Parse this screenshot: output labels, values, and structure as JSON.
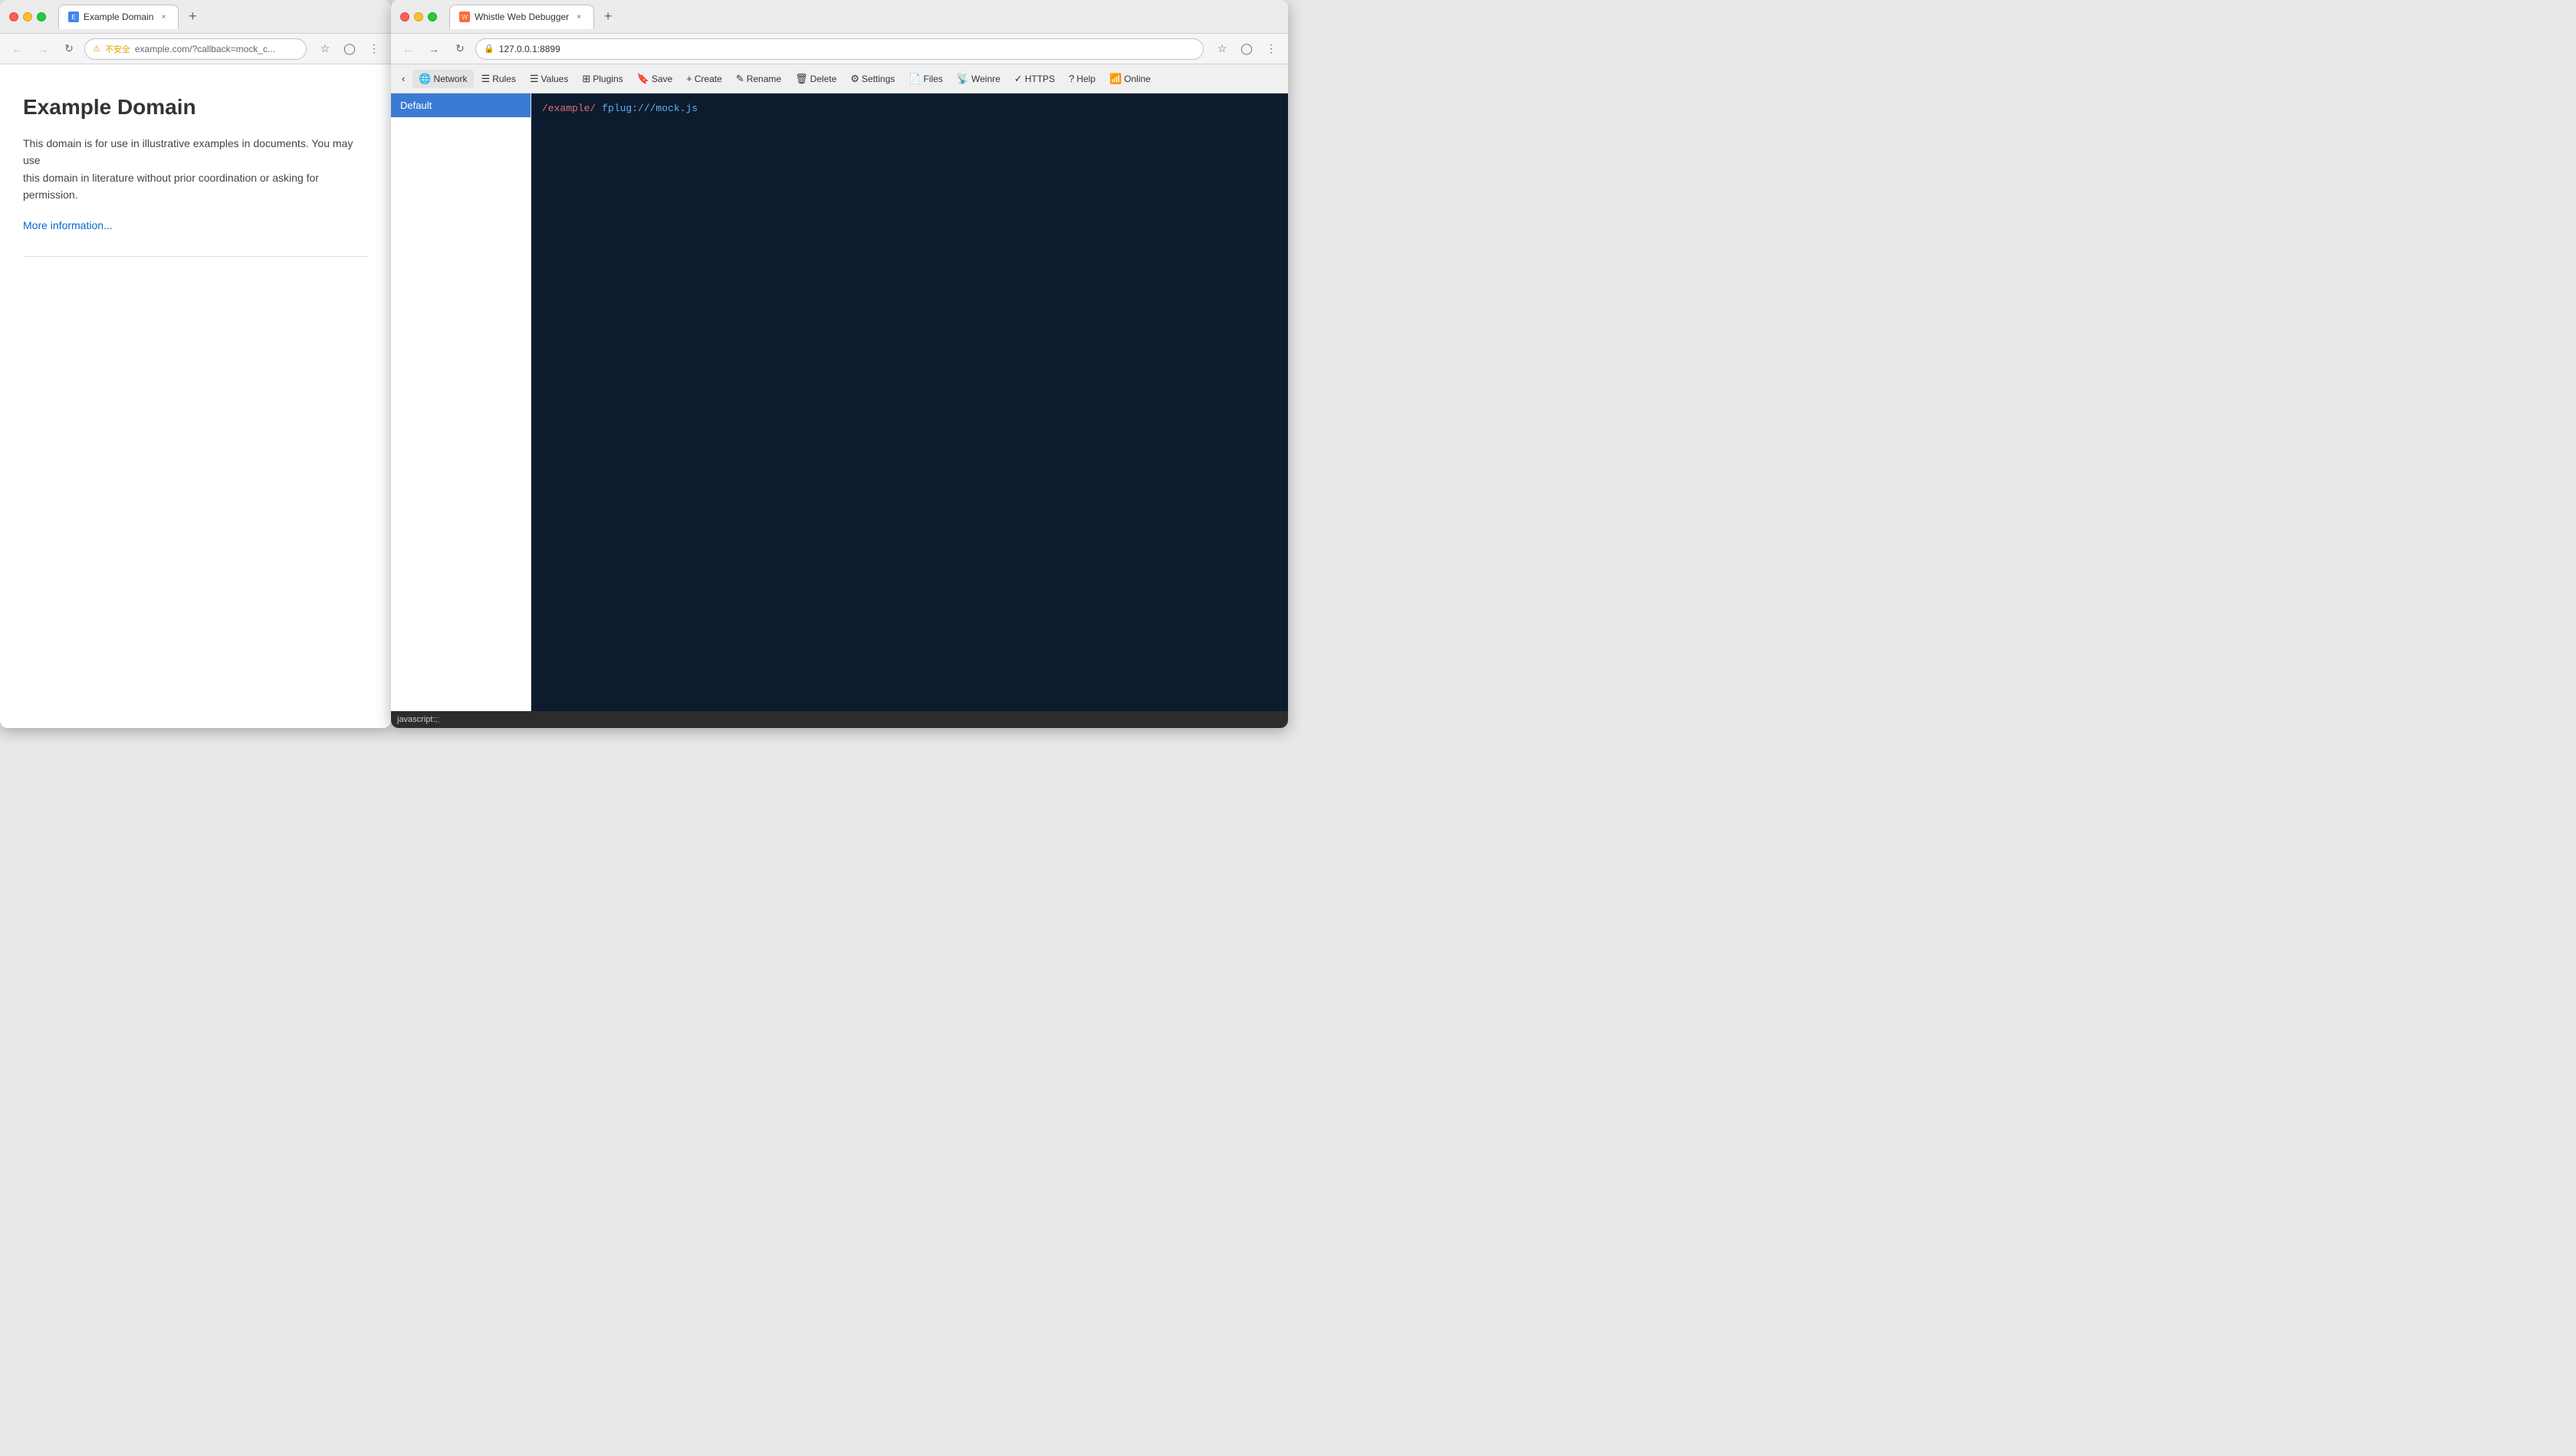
{
  "browser1": {
    "tab_label": "Example Domain",
    "tab_close": "×",
    "tab_new": "+",
    "nav": {
      "back": "←",
      "forward": "→",
      "reload": "↻",
      "security_label": "不安全",
      "url": "example.com/?callback=mock_c...",
      "bookmark_icon": "☆",
      "account_icon": "◯",
      "more_icon": "⋮"
    },
    "page": {
      "title": "Example Domain",
      "description_1": "This domain is for use in illustrative examples in documents. You may use",
      "description_2": "this domain in literature without prior coordination or asking for",
      "description_3": "permission.",
      "link_text": "More information..."
    }
  },
  "browser2": {
    "tab_label": "Whistle Web Debugger",
    "tab_close": "×",
    "tab_new": "+",
    "nav": {
      "back": "←",
      "forward": "→",
      "reload": "↻",
      "url": "127.0.0.1:8899",
      "bookmark_icon": "☆",
      "account_icon": "◯",
      "more_icon": "⋮"
    },
    "toolbar": {
      "back": "‹",
      "network": "Network",
      "rules": "Rules",
      "values": "Values",
      "plugins": "Plugins",
      "save": "Save",
      "create": "Create",
      "rename": "Rename",
      "delete": "Delete",
      "settings": "Settings",
      "files": "Files",
      "weinre": "Weinre",
      "https": "HTTPS",
      "help": "Help",
      "online": "Online"
    },
    "sidebar": {
      "items": [
        {
          "label": "Default",
          "selected": true
        }
      ]
    },
    "editor": {
      "line1_path": "/example/",
      "line1_target": "fplug:///mock.js"
    },
    "status_bar": "javascript:;"
  }
}
